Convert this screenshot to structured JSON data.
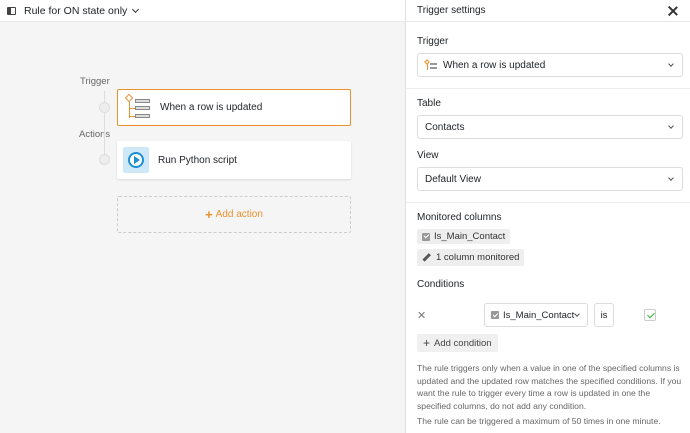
{
  "header": {
    "rule_title": "Rule for ON state only"
  },
  "flow": {
    "trigger_label": "Trigger",
    "actions_label": "Actions",
    "trigger_card": "When a row is updated",
    "action_card": "Run Python script",
    "add_action": "Add action"
  },
  "panel": {
    "title": "Trigger settings",
    "trigger": {
      "label": "Trigger",
      "value": "When a row is updated"
    },
    "table": {
      "label": "Table",
      "value": "Contacts"
    },
    "view": {
      "label": "View",
      "value": "Default View"
    },
    "monitored": {
      "label": "Monitored columns",
      "column": "Is_Main_Contact",
      "button": "1 column monitored"
    },
    "conditions": {
      "label": "Conditions",
      "rows": [
        {
          "column": "Is_Main_Contact",
          "operator": "is",
          "value_checked": true
        }
      ],
      "add": "Add condition"
    },
    "help_text": "The rule triggers only when a value in one of the specified columns is updated and the updated row matches the specified conditions. If you want the rule to trigger every time a row is updated in one the specified columns, do not add any condition.",
    "limit_text": "The rule can be triggered a maximum of 50 times in one minute."
  },
  "colors": {
    "accent": "#e8912d",
    "python_blue": "#1d8fd6",
    "check_green": "#2eb82e"
  }
}
